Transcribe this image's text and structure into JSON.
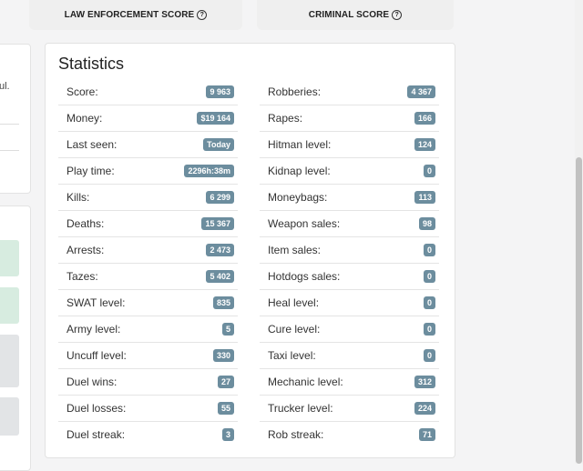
{
  "header": {
    "law_enforcement_score": "LAW ENFORCEMENT SCORE",
    "criminal_score": "CRIMINAL SCORE",
    "help_glyph": "?"
  },
  "left_panel": {
    "fragment_text": "ul."
  },
  "statistics": {
    "title": "Statistics",
    "left_column": [
      {
        "label": "Score:",
        "value": "9 963"
      },
      {
        "label": "Money:",
        "value": "$19 164"
      },
      {
        "label": "Last seen:",
        "value": "Today"
      },
      {
        "label": "Play time:",
        "value": "2296h:38m"
      },
      {
        "label": "Kills:",
        "value": "6 299"
      },
      {
        "label": "Deaths:",
        "value": "15 367"
      },
      {
        "label": "Arrests:",
        "value": "2 473"
      },
      {
        "label": "Tazes:",
        "value": "5 402"
      },
      {
        "label": "SWAT level:",
        "value": "835"
      },
      {
        "label": "Army level:",
        "value": "5"
      },
      {
        "label": "Uncuff level:",
        "value": "330"
      },
      {
        "label": "Duel wins:",
        "value": "27"
      },
      {
        "label": "Duel losses:",
        "value": "55"
      },
      {
        "label": "Duel streak:",
        "value": "3"
      }
    ],
    "right_column": [
      {
        "label": "Robberies:",
        "value": "4 367"
      },
      {
        "label": "Rapes:",
        "value": "166"
      },
      {
        "label": "Hitman level:",
        "value": "124"
      },
      {
        "label": "Kidnap level:",
        "value": "0"
      },
      {
        "label": "Moneybags:",
        "value": "113"
      },
      {
        "label": "Weapon sales:",
        "value": "98"
      },
      {
        "label": "Item sales:",
        "value": "0"
      },
      {
        "label": "Hotdogs sales:",
        "value": "0"
      },
      {
        "label": "Heal level:",
        "value": "0"
      },
      {
        "label": "Cure level:",
        "value": "0"
      },
      {
        "label": "Taxi level:",
        "value": "0"
      },
      {
        "label": "Mechanic level:",
        "value": "312"
      },
      {
        "label": "Trucker level:",
        "value": "224"
      },
      {
        "label": "Rob streak:",
        "value": "71"
      }
    ]
  },
  "colors": {
    "badge": "#6c8d9e",
    "green_button": "#d7ece0",
    "grey_button": "#e2e4e6"
  }
}
